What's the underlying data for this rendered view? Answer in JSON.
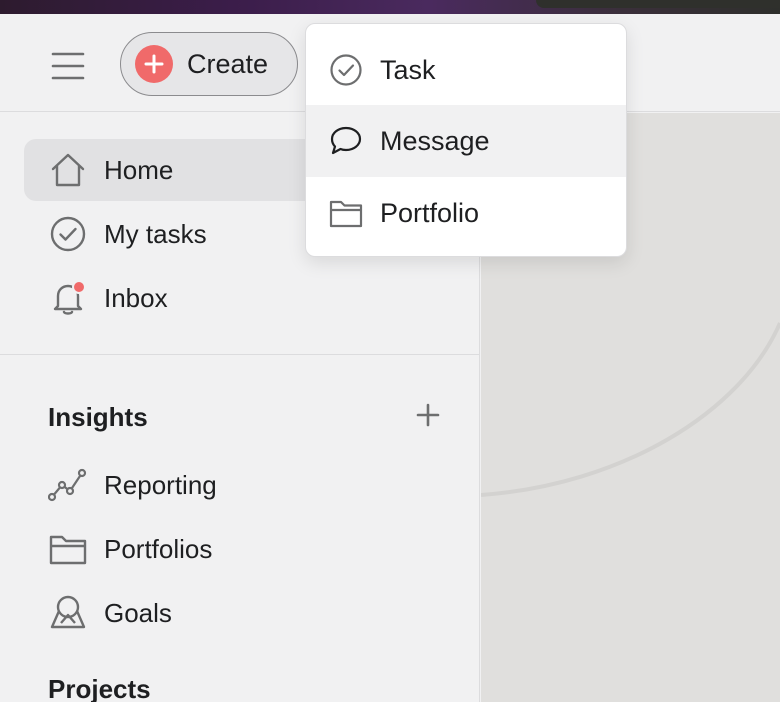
{
  "header": {
    "create_label": "Create"
  },
  "sidebar": {
    "nav": [
      {
        "label": "Home",
        "icon": "home-icon",
        "active": true
      },
      {
        "label": "My tasks",
        "icon": "check-circle-icon"
      },
      {
        "label": "Inbox",
        "icon": "bell-icon",
        "has_notification": true
      }
    ],
    "insights": {
      "title": "Insights",
      "items": [
        {
          "label": "Reporting",
          "icon": "reporting-icon"
        },
        {
          "label": "Portfolios",
          "icon": "folder-icon"
        },
        {
          "label": "Goals",
          "icon": "goals-icon"
        }
      ]
    },
    "projects": {
      "title": "Projects"
    }
  },
  "create_menu": {
    "items": [
      {
        "label": "Task",
        "icon": "check-circle-icon"
      },
      {
        "label": "Message",
        "icon": "speech-bubble-icon",
        "hovered": true
      },
      {
        "label": "Portfolio",
        "icon": "folder-icon"
      }
    ]
  },
  "colors": {
    "accent": "#f06a6a",
    "sidebar_bg": "#f1f1f2",
    "main_bg": "#e0dfdd",
    "text": "#1e1f21",
    "icon": "#6d6e6f"
  }
}
